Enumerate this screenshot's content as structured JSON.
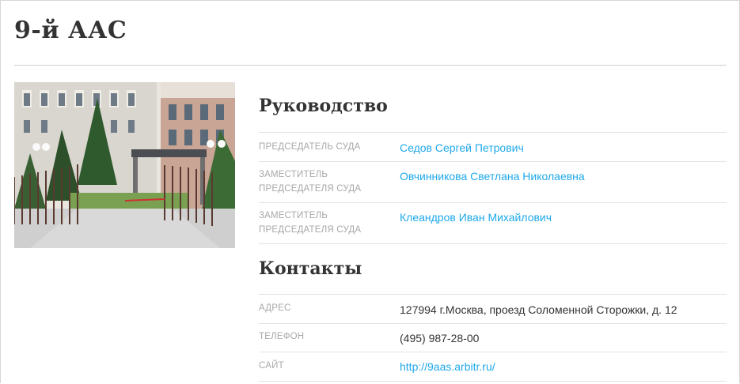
{
  "title": "9-й ААС",
  "leadership": {
    "heading": "Руководство",
    "rows": [
      {
        "label": "ПРЕДСЕДАТЕЛЬ СУДА",
        "value": "Седов Сергей Петрович"
      },
      {
        "label": "ЗАМЕСТИТЕЛЬ ПРЕДСЕДАТЕЛЯ СУДА",
        "value": "Овчинникова Светлана Николаевна"
      },
      {
        "label": "ЗАМЕСТИТЕЛЬ ПРЕДСЕДАТЕЛЯ СУДА",
        "value": "Клеандров Иван Михайлович"
      }
    ]
  },
  "contacts": {
    "heading": "Контакты",
    "rows": [
      {
        "label": "АДРЕС",
        "value": "127994 г.Москва, проезд Соломенной Сторожки, д. 12"
      },
      {
        "label": "ТЕЛЕФОН",
        "value": "(495) 987-28-00"
      },
      {
        "label": "САЙТ",
        "value": "http://9aas.arbitr.ru/"
      }
    ]
  },
  "colors": {
    "link": "#1fa9ea",
    "label": "#a8a8a8",
    "text": "#333333"
  }
}
